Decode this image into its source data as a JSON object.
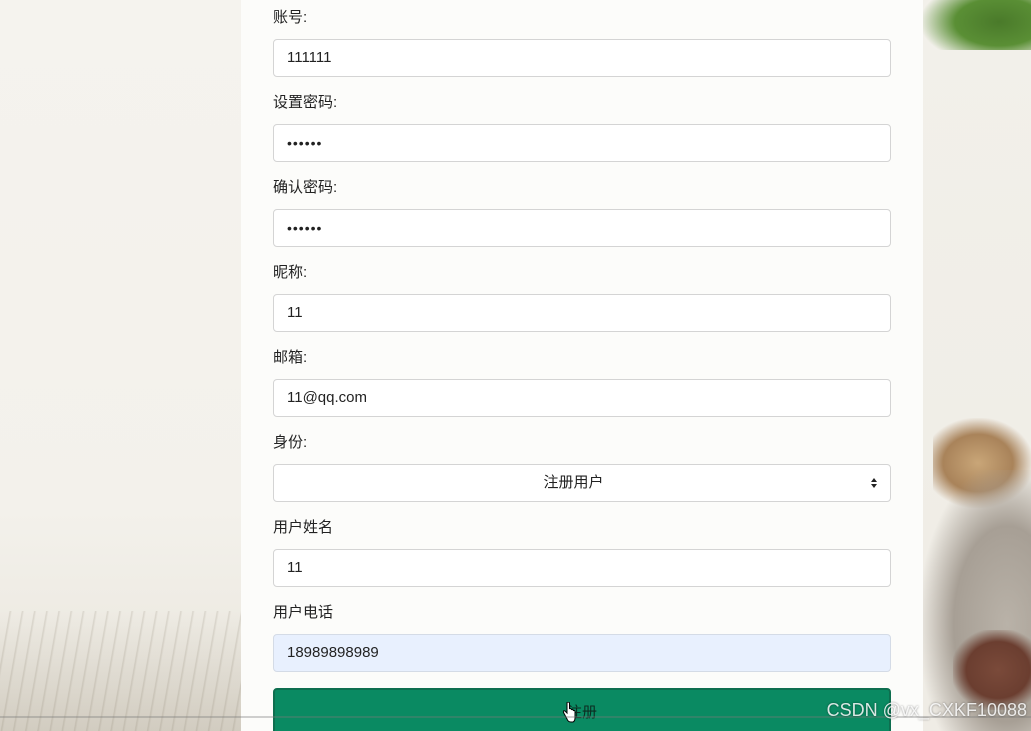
{
  "form": {
    "account": {
      "label": "账号:",
      "value": "111111"
    },
    "set_password": {
      "label": "设置密码:",
      "value": "••••••"
    },
    "confirm_password": {
      "label": "确认密码:",
      "value": "••••••"
    },
    "nickname": {
      "label": "昵称:",
      "value": "11"
    },
    "email": {
      "label": "邮箱:",
      "value": "11@qq.com"
    },
    "role": {
      "label": "身份:",
      "selected": "注册用户"
    },
    "user_name": {
      "label": "用户姓名",
      "value": "11"
    },
    "user_phone": {
      "label": "用户电话",
      "value": "18989898989"
    },
    "register_button": "注册"
  },
  "watermark": "CSDN @vx_CXKF10088",
  "colors": {
    "button_green": "#0a8a62",
    "autofill_blue": "#e8f0fe",
    "panel_bg": "#fcfcfa"
  }
}
